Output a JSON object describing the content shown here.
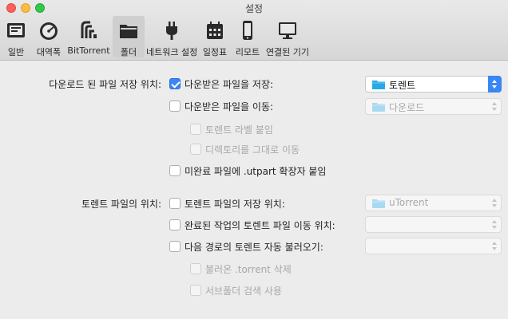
{
  "window": {
    "title": "설정"
  },
  "toolbar": {
    "tabs": [
      {
        "label": "일반",
        "icon": "general-icon",
        "active": false
      },
      {
        "label": "대역폭",
        "icon": "bandwidth-gauge-icon",
        "active": false
      },
      {
        "label": "BitTorrent",
        "icon": "bittorrent-icon",
        "active": false
      },
      {
        "label": "폴더",
        "icon": "folder-icon",
        "active": true
      },
      {
        "label": "네트워크 설정",
        "icon": "plug-icon",
        "active": false
      },
      {
        "label": "일정표",
        "icon": "calendar-icon",
        "active": false
      },
      {
        "label": "리모트",
        "icon": "phone-icon",
        "active": false
      },
      {
        "label": "연결된 기기",
        "icon": "monitor-icon",
        "active": false
      }
    ]
  },
  "downloads": {
    "section_label": "다운로드 된 파일 저장 위치:",
    "save_to": {
      "label": "다운받은 파일을 저장:",
      "checked": true,
      "folder": "토렌트"
    },
    "move_to": {
      "label": "다운받은 파일을 이동:",
      "checked": false,
      "folder": "다운로드"
    },
    "append_label": {
      "label": "토렌트 라벨 붙임",
      "checked": false
    },
    "keep_dir": {
      "label": "디렉토리를 그대로 이동",
      "checked": false
    },
    "utpart": {
      "label": "미완료 파일에 .utpart 확장자 붙임",
      "checked": false
    }
  },
  "torrents": {
    "section_label": "토렌트 파일의 위치:",
    "store_torrent": {
      "label": "토렌트 파일의 저장 위치:",
      "checked": false,
      "folder": "uTorrent"
    },
    "move_completed": {
      "label": "완료된 작업의 토렌트 파일 이동 위치:",
      "checked": false,
      "folder": ""
    },
    "autoload": {
      "label": "다음 경로의 토렌트 자동 불러오기:",
      "checked": false,
      "folder": ""
    },
    "delete_loaded": {
      "label": "불러온 .torrent 삭제",
      "checked": false
    },
    "search_subfolders": {
      "label": "서브폴더 검색 사용",
      "checked": false
    }
  },
  "colors": {
    "accent": "#3a86f6",
    "folder_blue": "#27a9e8",
    "background": "#ececec"
  }
}
